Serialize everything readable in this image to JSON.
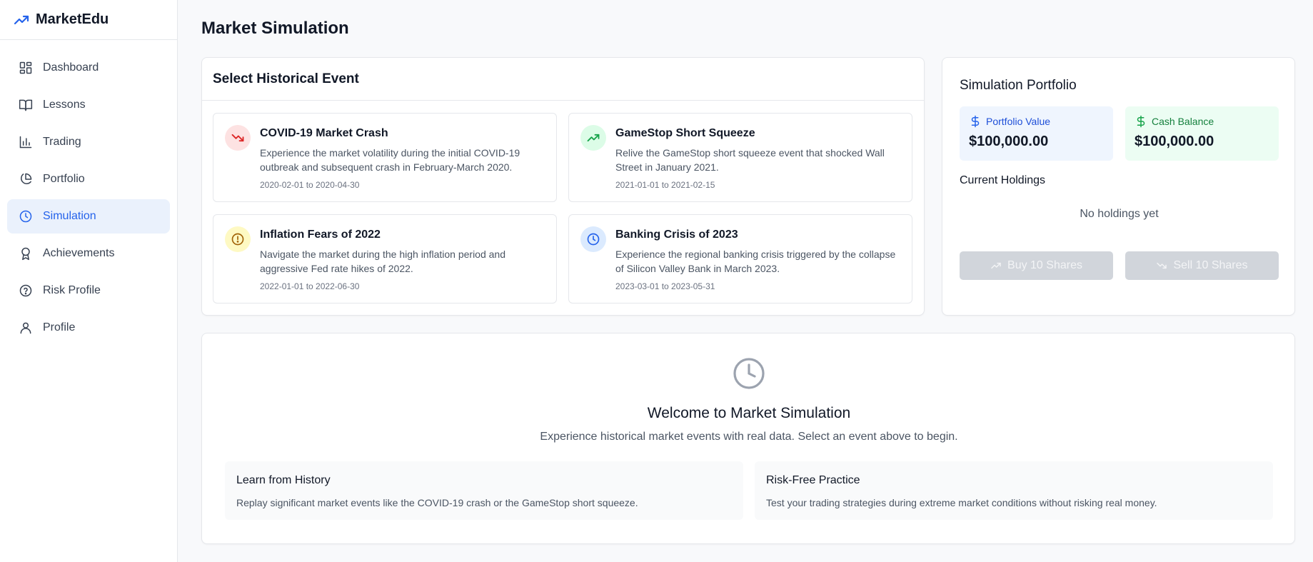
{
  "app": {
    "name": "MarketEdu"
  },
  "sidebar": {
    "items": [
      {
        "label": "Dashboard",
        "icon": "dashboard-icon"
      },
      {
        "label": "Lessons",
        "icon": "book-icon"
      },
      {
        "label": "Trading",
        "icon": "bar-chart-icon"
      },
      {
        "label": "Portfolio",
        "icon": "pie-chart-icon"
      },
      {
        "label": "Simulation",
        "icon": "clock-icon",
        "active": true
      },
      {
        "label": "Achievements",
        "icon": "award-icon"
      },
      {
        "label": "Risk Profile",
        "icon": "help-circle-icon"
      },
      {
        "label": "Profile",
        "icon": "user-icon"
      }
    ]
  },
  "page": {
    "title": "Market Simulation"
  },
  "events": {
    "heading": "Select Historical Event",
    "items": [
      {
        "title": "COVID-19 Market Crash",
        "description": "Experience the market volatility during the initial COVID-19 outbreak and subsequent crash in February-March 2020.",
        "dates": "2020-02-01 to 2020-04-30",
        "icon": "trending-down-icon",
        "color": "#dc2626",
        "bg": "#fde2e2"
      },
      {
        "title": "GameStop Short Squeeze",
        "description": "Relive the GameStop short squeeze event that shocked Wall Street in January 2021.",
        "dates": "2021-01-01 to 2021-02-15",
        "icon": "trending-up-icon",
        "color": "#16a34a",
        "bg": "#dcfce7"
      },
      {
        "title": "Inflation Fears of 2022",
        "description": "Navigate the market during the high inflation period and aggressive Fed rate hikes of 2022.",
        "dates": "2022-01-01 to 2022-06-30",
        "icon": "alert-circle-icon",
        "color": "#a16207",
        "bg": "#fef9c3"
      },
      {
        "title": "Banking Crisis of 2023",
        "description": "Experience the regional banking crisis triggered by the collapse of Silicon Valley Bank in March 2023.",
        "dates": "2023-03-01 to 2023-05-31",
        "icon": "clock-icon",
        "color": "#2563eb",
        "bg": "#dbeafe"
      }
    ]
  },
  "portfolio": {
    "title": "Simulation Portfolio",
    "value_label": "Portfolio Value",
    "value": "$100,000.00",
    "cash_label": "Cash Balance",
    "cash": "$100,000.00",
    "holdings_title": "Current Holdings",
    "holdings_empty": "No holdings yet",
    "buy_label": "Buy 10 Shares",
    "sell_label": "Sell 10 Shares"
  },
  "welcome": {
    "title": "Welcome to Market Simulation",
    "subtitle": "Experience historical market events with real data. Select an event above to begin.",
    "features": [
      {
        "title": "Learn from History",
        "description": "Replay significant market events like the COVID-19 crash or the GameStop short squeeze."
      },
      {
        "title": "Risk-Free Practice",
        "description": "Test your trading strategies during extreme market conditions without risking real money."
      }
    ]
  },
  "colors": {
    "accent": "#2563eb",
    "green": "#16a34a",
    "value_bg": "#eff5fe",
    "cash_bg": "#ecfdf3"
  }
}
